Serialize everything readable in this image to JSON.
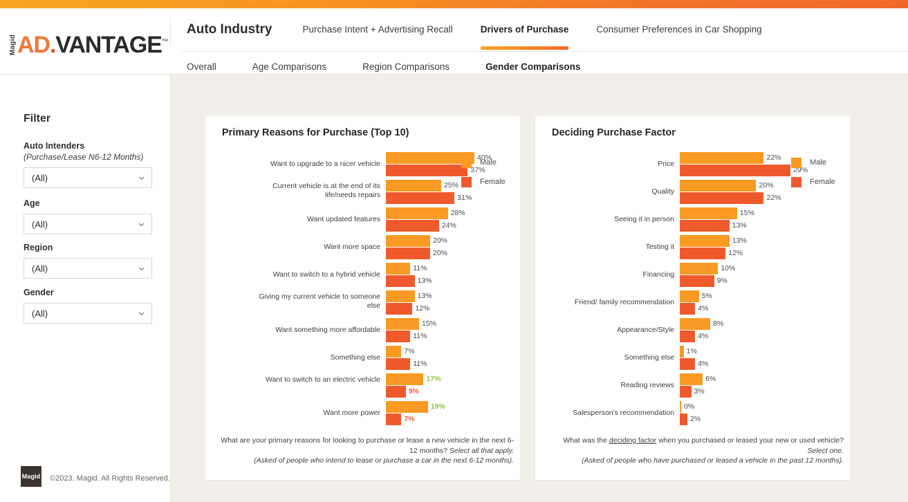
{
  "header": {
    "logo": {
      "magid": "Magid",
      "ad": "AD",
      "dot": ".",
      "vantage": "VANTAGE",
      "tm": "™"
    },
    "brand_title": "Auto Industry",
    "primary_nav": [
      {
        "label": "Purchase Intent + Advertising Recall",
        "active": false
      },
      {
        "label": "Drivers of Purchase",
        "active": true
      },
      {
        "label": "Consumer Preferences in Car Shopping",
        "active": false
      }
    ],
    "sub_nav": [
      {
        "label": "Overall",
        "active": false
      },
      {
        "label": "Age Comparisons",
        "active": false
      },
      {
        "label": "Region Comparisons",
        "active": false
      },
      {
        "label": "Gender Comparisons",
        "active": true
      }
    ]
  },
  "sidebar": {
    "title": "Filter",
    "filters": [
      {
        "label": "Auto Intenders",
        "sublabel": "(Purchase/Lease N6-12 Months)",
        "value": "(All)"
      },
      {
        "label": "Age",
        "sublabel": "",
        "value": "(All)"
      },
      {
        "label": "Region",
        "sublabel": "",
        "value": "(All)"
      },
      {
        "label": "Gender",
        "sublabel": "",
        "value": "(All)"
      }
    ],
    "footer_logo": "Magid",
    "copyright": "©2023. Magid. All Rights Reserved."
  },
  "colors": {
    "male": "#f89a23",
    "female": "#ef5a2c",
    "significant_higher": "#8dc63f",
    "significant_lower": "#f15a40",
    "page_background": "#f2efea",
    "gradient_start": "#f5a623",
    "gradient_end": "#f2682a"
  },
  "chart_data": [
    {
      "type": "bar",
      "title": "Primary Reasons for Purchase (Top 10)",
      "orientation": "horizontal",
      "grouped": true,
      "legend": [
        "Male",
        "Female"
      ],
      "legend_position": "right",
      "grid": false,
      "xlabel": "",
      "ylabel": "",
      "value_suffix": "%",
      "categories": [
        "Want to upgrade to a nicer vehicle",
        "Current vehicle is at the end of its life/needs repairs",
        "Want updated features",
        "Want more space",
        "Want to switch to a hybrid vehicle",
        "Giving my current vehicle to someone else",
        "Want something more affordable",
        "Something else",
        "Want to switch to an electric vehicle",
        "Want more power"
      ],
      "series": [
        {
          "name": "Male",
          "values": [
            40,
            25,
            28,
            20,
            11,
            13,
            15,
            7,
            17,
            19
          ]
        },
        {
          "name": "Female",
          "values": [
            37,
            31,
            24,
            20,
            13,
            12,
            11,
            11,
            9,
            7
          ]
        }
      ],
      "significance": {
        "Male": [
          null,
          null,
          null,
          null,
          null,
          null,
          null,
          null,
          "up",
          "up"
        ],
        "Female": [
          null,
          null,
          null,
          null,
          null,
          null,
          null,
          null,
          "down",
          "down"
        ]
      },
      "footnote": {
        "line1": "What are your primary reasons for looking to purchase or lease a new vehicle in the next 6-",
        "line2_plain": "12 months? ",
        "line2_italic": "Select all that apply.",
        "line3_italic": "(Asked of people who intend to lease or purchase a car in the next 6-12 months)."
      }
    },
    {
      "type": "bar",
      "title": "Deciding Purchase Factor",
      "orientation": "horizontal",
      "grouped": true,
      "legend": [
        "Male",
        "Female"
      ],
      "legend_position": "right",
      "grid": false,
      "xlabel": "",
      "ylabel": "",
      "value_suffix": "%",
      "categories": [
        "Price",
        "Quality",
        "Seeing it in person",
        "Testing it",
        "Financing",
        "Friend/ family recommendation",
        "Appearance/Style",
        "Something else",
        "Reading reviews",
        "Salesperson's recommendation"
      ],
      "series": [
        {
          "name": "Male",
          "values": [
            22,
            20,
            15,
            13,
            10,
            5,
            8,
            1,
            6,
            0
          ]
        },
        {
          "name": "Female",
          "values": [
            29,
            22,
            13,
            12,
            9,
            4,
            4,
            4,
            3,
            2
          ]
        }
      ],
      "significance": {
        "Male": [
          null,
          null,
          null,
          null,
          null,
          null,
          null,
          null,
          null,
          null
        ],
        "Female": [
          null,
          null,
          null,
          null,
          null,
          null,
          null,
          null,
          null,
          null
        ]
      },
      "footnote": {
        "line1_pre": "What was the ",
        "line1_underline": "deciding factor",
        "line1_post": " when you purchased or leased your new or used vehicle?",
        "line2_italic": "Select one.",
        "line3_italic": "(Asked of people who have purchased or leased a vehicle in the past 12 months)."
      }
    }
  ]
}
